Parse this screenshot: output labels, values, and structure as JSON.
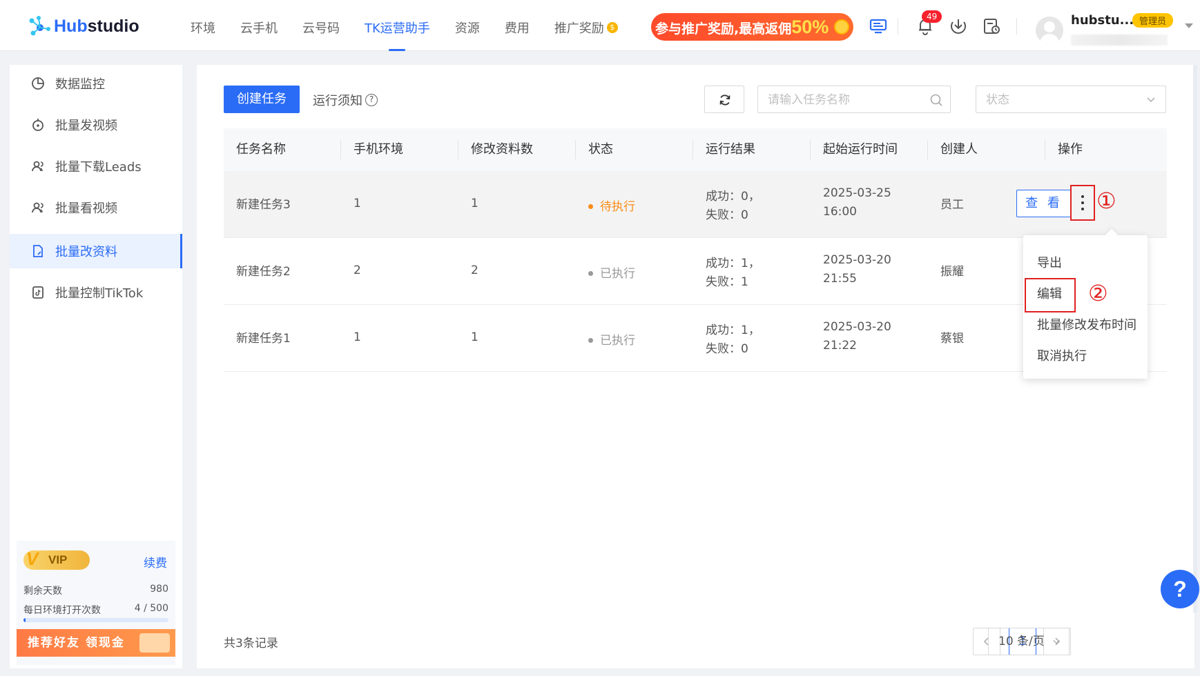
{
  "brand": {
    "name_prefix": "Hub",
    "name_suffix": "studio",
    "accent": "#2b6cf6"
  },
  "nav": {
    "items": [
      {
        "label": "环境"
      },
      {
        "label": "云手机"
      },
      {
        "label": "云号码"
      },
      {
        "label": "TK运营助手",
        "active": true
      },
      {
        "label": "资源"
      },
      {
        "label": "费用"
      },
      {
        "label": "推广奖励"
      }
    ]
  },
  "promo": {
    "text": "参与推广奖励,最高返佣",
    "highlight": "50%"
  },
  "header": {
    "notification_count": "49",
    "username": "hubstu...",
    "role": "管理员",
    "icons": [
      "monitor-icon",
      "bell-icon",
      "download-icon",
      "schedule-icon"
    ]
  },
  "sidebar": {
    "items": [
      {
        "label": "数据监控",
        "icon": "chart-pie-icon"
      },
      {
        "label": "批量发视频",
        "icon": "upload-video-icon"
      },
      {
        "label": "批量下载Leads",
        "icon": "users-icon"
      },
      {
        "label": "批量看视频",
        "icon": "users-icon"
      },
      {
        "label": "批量改资料",
        "icon": "doc-edit-icon",
        "active": true
      },
      {
        "label": "批量控制TikTok",
        "icon": "tiktok-icon"
      }
    ],
    "vip": {
      "badge": "VIP",
      "renew": "续费",
      "days_label": "剩余天数",
      "days_value": "980",
      "opens_label": "每日环境打开次数",
      "opens_value": "4 / 500",
      "opens_used": 4,
      "opens_total": 500
    },
    "refer": "推荐好友 领现金"
  },
  "toolbar": {
    "create_label": "创建任务",
    "notice_label": "运行须知",
    "search_placeholder": "请输入任务名称",
    "status_placeholder": "状态"
  },
  "table": {
    "columns": [
      "任务名称",
      "手机环境",
      "修改资料数",
      "状态",
      "运行结果",
      "起始运行时间",
      "创建人",
      "操作"
    ],
    "rows": [
      {
        "name": "新建任务3",
        "env": "1",
        "count": "1",
        "status": "待执行",
        "status_color": "#fa8c16",
        "success": "成功：0，",
        "fail": "失败：0",
        "date": "2025-03-25",
        "time": "16:00",
        "creator": "员工"
      },
      {
        "name": "新建任务2",
        "env": "2",
        "count": "2",
        "status": "已执行",
        "status_color": "#999999",
        "success": "成功：1，",
        "fail": "失败：1",
        "date": "2025-03-20",
        "time": "21:55",
        "creator": "振耀"
      },
      {
        "name": "新建任务1",
        "env": "1",
        "count": "1",
        "status": "已执行",
        "status_color": "#999999",
        "success": "成功：1，",
        "fail": "失败：0",
        "date": "2025-03-20",
        "time": "21:22",
        "creator": "蔡银"
      }
    ],
    "view_label": "查 看"
  },
  "dropdown": {
    "items": [
      "导出",
      "编辑",
      "批量修改发布时间",
      "取消执行"
    ]
  },
  "annotations": {
    "step1": "①",
    "step2": "②"
  },
  "footer": {
    "total": "共3条记录",
    "current_page": "1",
    "page_size": "10 条/页"
  },
  "help": "?"
}
